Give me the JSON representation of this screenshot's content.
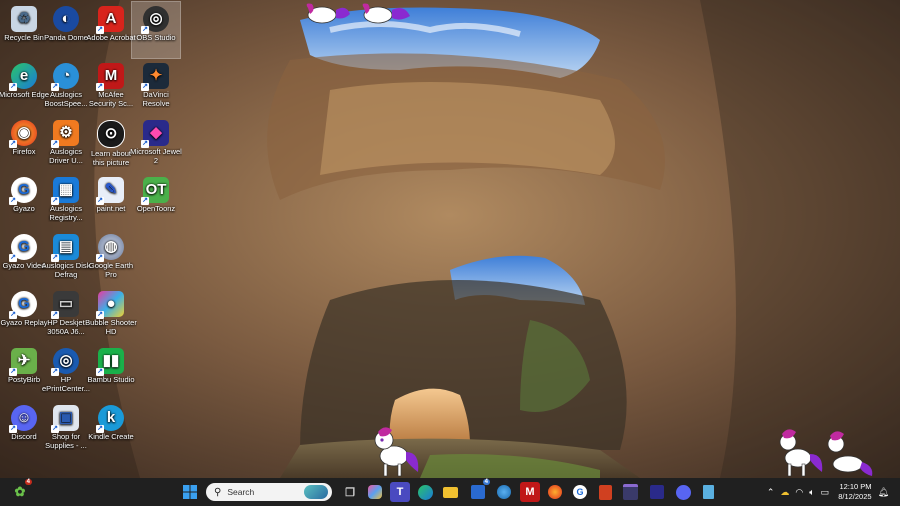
{
  "desktop": {
    "icons": [
      {
        "label": "Recycle Bin",
        "icon": "recycle-bin-icon"
      },
      {
        "label": "Panda Dome",
        "icon": "panda-dome-icon"
      },
      {
        "label": "Adobe Acrobat",
        "icon": "adobe-acrobat-icon"
      },
      {
        "label": "OBS Studio",
        "icon": "obs-studio-icon"
      },
      {
        "label": "Microsoft Edge",
        "icon": "edge-icon"
      },
      {
        "label": "Auslogics BoostSpee...",
        "icon": "auslogics-boostspeed-icon"
      },
      {
        "label": "McAfee Security Sc...",
        "icon": "mcafee-icon"
      },
      {
        "label": "DaVinci Resolve",
        "icon": "davinci-resolve-icon"
      },
      {
        "label": "Firefox",
        "icon": "firefox-icon"
      },
      {
        "label": "Auslogics Driver U...",
        "icon": "auslogics-driver-updater-icon"
      },
      {
        "label": "Learn about this picture",
        "icon": "learn-about-picture-icon"
      },
      {
        "label": "Microsoft Jewel 2",
        "icon": "microsoft-jewel-icon"
      },
      {
        "label": "Gyazo",
        "icon": "gyazo-icon"
      },
      {
        "label": "Auslogics Registry...",
        "icon": "auslogics-registry-icon"
      },
      {
        "label": "paint.net",
        "icon": "paint-net-icon"
      },
      {
        "label": "OpenToonz",
        "icon": "opentoonz-icon"
      },
      {
        "label": "Gyazo Video",
        "icon": "gyazo-video-icon"
      },
      {
        "label": "Auslogics Disk Defrag",
        "icon": "auslogics-disk-defrag-icon"
      },
      {
        "label": "Google Earth Pro",
        "icon": "google-earth-pro-icon"
      },
      {
        "label": "Gyazo Replay",
        "icon": "gyazo-replay-icon"
      },
      {
        "label": "HP Deskjet 3050A J6...",
        "icon": "hp-deskjet-icon"
      },
      {
        "label": "Bubble Shooter HD",
        "icon": "bubble-shooter-icon"
      },
      {
        "label": "PostyBirb",
        "icon": "postybirb-icon"
      },
      {
        "label": "HP ePrintCenter...",
        "icon": "hp-eprintcenter-icon"
      },
      {
        "label": "Bambu Studio",
        "icon": "bambu-studio-icon"
      },
      {
        "label": "Discord",
        "icon": "discord-icon"
      },
      {
        "label": "Shop for Supplies - ...",
        "icon": "shop-supplies-icon"
      },
      {
        "label": "Kindle Create",
        "icon": "kindle-create-icon"
      }
    ]
  },
  "taskbar": {
    "search_placeholder": "Search",
    "widget_badge": "4",
    "store_badge": "4",
    "pinned": [
      "start-icon",
      "search-icon",
      "task-view-icon",
      "copilot-icon",
      "teams-icon",
      "edge-icon",
      "file-explorer-icon",
      "microsoft-store-icon",
      "app-icon",
      "mcafee-icon",
      "firefox-icon",
      "gyazo-icon",
      "app-icon",
      "app-icon",
      "app-icon",
      "discord-icon",
      "notepad-icon"
    ],
    "clock": {
      "time": "12:10 PM",
      "date": "8/12/2025"
    }
  },
  "colors": {
    "taskbar": "#202020",
    "accent": "#0078d4"
  }
}
